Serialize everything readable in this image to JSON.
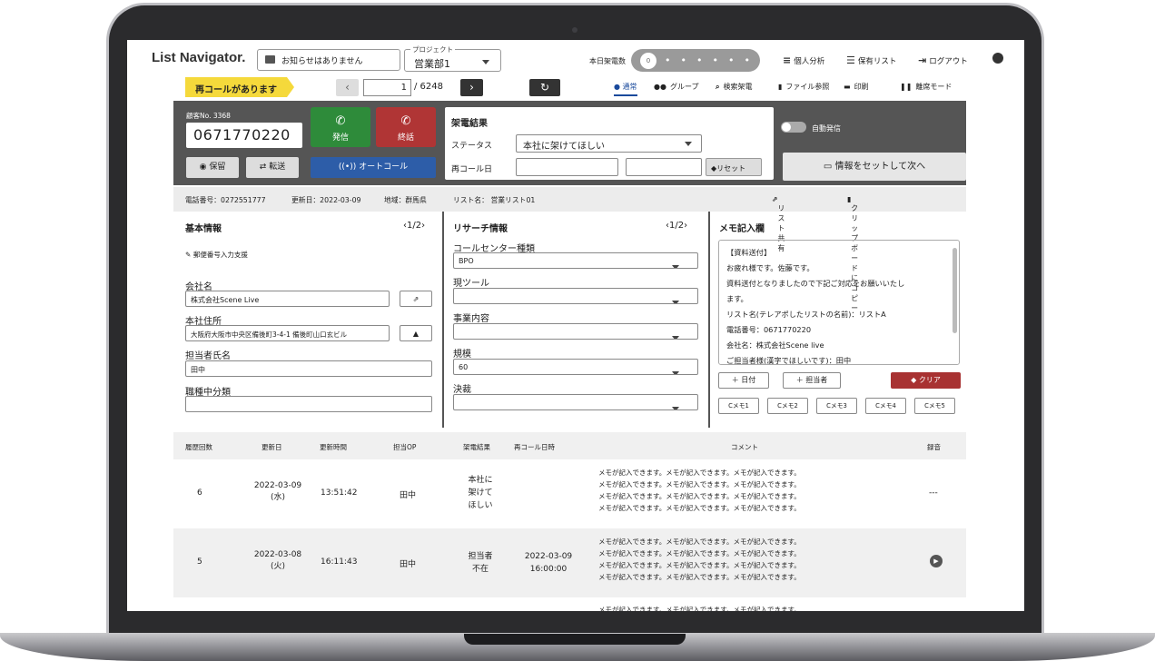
{
  "header": {
    "logo": "List Navigator.",
    "notice": "お知らせはありません",
    "project_label": "プロジェクト",
    "project_value": "営業部1",
    "daily_calls_label": "本日架電数",
    "daily_calls_value": "0",
    "personal": "個人分析",
    "saved_list": "保有リスト",
    "logout": "ログアウト"
  },
  "toolbar": {
    "recall_alert": "再コールがあります",
    "page_current": "1",
    "page_total": "/ 6248",
    "mode_normal": "通常",
    "mode_group": "グループ",
    "search_call": "検索架電",
    "file_ref": "ファイル参照",
    "print": "印刷",
    "away": "離席モード"
  },
  "call": {
    "customer_no": "顧客No. 3368",
    "phone": "0671770220",
    "dial": "発信",
    "hangup": "終話",
    "hold": "保留",
    "transfer": "転送",
    "autocall": "オートコール",
    "result_title": "架電結果",
    "status_label": "ステータス",
    "status_value": "本社に架けてほしい",
    "recall_date_label": "再コール日",
    "reset": "リセット",
    "auto_dial": "自動発信",
    "next": "情報をセットして次へ"
  },
  "info": {
    "phone": "電話番号：0272551777",
    "updated": "更新日：2022-03-09",
    "region": "地域：群馬県",
    "list": "リスト名：  営業リスト01",
    "share": "リスト共有",
    "clipboard": "クリップボードにコピー"
  },
  "basic": {
    "title": "基本情報",
    "pager": "1/2",
    "zip_helper": "郵便番号入力支援",
    "company_label": "会社名",
    "company": "株式会社Scene Live",
    "address_label": "本社住所",
    "address": "大阪府大阪市中央区備後町3-4-1 備後町山口玄ビル",
    "person_label": "担当者氏名",
    "person": "田中",
    "job_label": "職種中分類",
    "job": ""
  },
  "research": {
    "title": "リサーチ情報",
    "pager": "1/2",
    "cc_label": "コールセンター種類",
    "cc": "BPO",
    "tool_label": "現ツール",
    "tool": "",
    "biz_label": "事業内容",
    "biz": "",
    "scale_label": "規模",
    "scale": "60",
    "decision_label": "決裁",
    "decision": ""
  },
  "memo": {
    "title": "メモ記入欄",
    "lines": [
      "【資料送付】",
      "お疲れ様です。佐藤です。",
      "資料送付となりましたので下記ご対応をお願いいたし",
      "ます。",
      "リスト名(テレアポしたリストの名前)：リストA",
      "電話番号：0671770220",
      "会社名：株式会社Scene live",
      "ご担当者様(漢字でほしいです)：田中"
    ],
    "add_date": "日付",
    "add_person": "担当者",
    "clear": "クリア",
    "c_buttons": [
      "Cメモ1",
      "Cメモ2",
      "Cメモ3",
      "Cメモ4",
      "Cメモ5"
    ]
  },
  "history": {
    "headers": [
      "履歴回数",
      "更新日",
      "更新時間",
      "担当OP",
      "架電結果",
      "再コール日時",
      "コメント",
      "録音"
    ],
    "rows": [
      {
        "count": "6",
        "date": "2022-03-09",
        "weekday": "(水)",
        "time": "13:51:42",
        "op": "田中",
        "result": [
          "本社に",
          "架けて",
          "ほしい"
        ],
        "recall_date": "",
        "recall_time": "",
        "rec": "---"
      },
      {
        "count": "5",
        "date": "2022-03-08",
        "weekday": "(火)",
        "time": "16:11:43",
        "op": "田中",
        "result": [
          "担当者",
          "不在"
        ],
        "recall_date": "2022-03-09",
        "recall_time": "16:00:00",
        "rec": ""
      }
    ],
    "comment": "メモが記入できます。メモが記入できます。メモが記入できます。",
    "partial": "メモが記入できます。メモが記入できます。メモが記入できます。"
  },
  "colors": {
    "dial": "#2e8b3a",
    "hangup": "#b03535",
    "autocall": "#2d5da8",
    "recall": "#f5d93b",
    "accent": "#1a4a9c"
  }
}
